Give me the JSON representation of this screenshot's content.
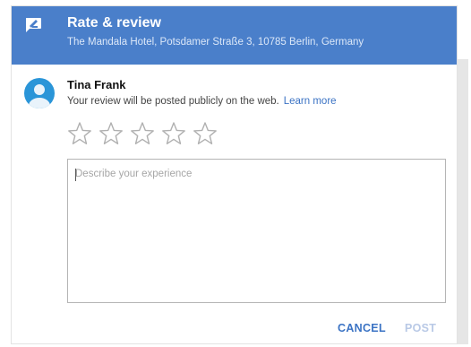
{
  "header": {
    "title": "Rate & review",
    "subtitle": "The Mandala Hotel, Potsdamer Straße 3, 10785 Berlin, Germany",
    "icon": "rate-review-icon"
  },
  "user": {
    "name": "Tina Frank",
    "avatar_icon": "account-avatar-icon",
    "avatar_color": "#2a95d8"
  },
  "notice": {
    "text": "Your review will be posted publicly on the web.",
    "link_label": "Learn more"
  },
  "rating": {
    "max": 5,
    "value": 0,
    "star_icon": "star-outline-icon"
  },
  "review": {
    "placeholder": "Describe your experience",
    "value": ""
  },
  "actions": {
    "cancel_label": "CANCEL",
    "post_label": "POST"
  },
  "colors": {
    "header": "#4a7fca",
    "accent": "#3b73c4",
    "disabled": "#b9c9e6",
    "star_outline": "#b0b0b0"
  }
}
